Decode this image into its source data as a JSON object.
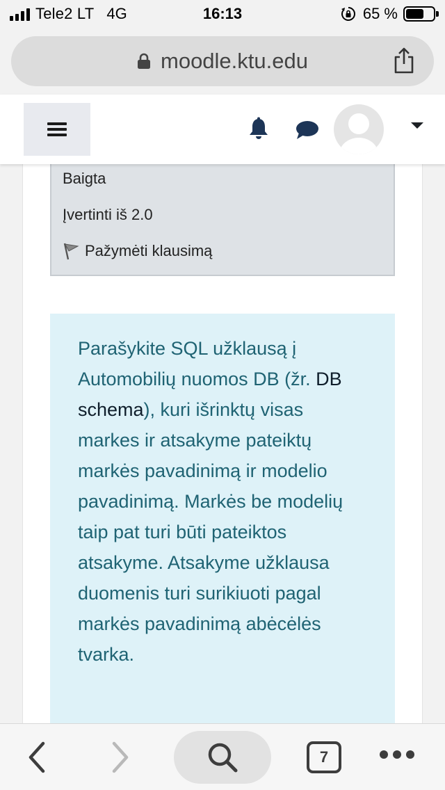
{
  "status_bar": {
    "carrier": "Tele2 LT",
    "network": "4G",
    "time": "16:13",
    "battery_percent": "65 %",
    "battery_level": 0.65
  },
  "browser": {
    "url": "moodle.ktu.edu"
  },
  "moodle_header": {
    "menu_icon": "hamburger-icon",
    "notifications_icon": "bell-icon",
    "messages_icon": "chat-bubble-icon",
    "avatar_icon": "user-avatar-icon",
    "dropdown_icon": "caret-down-icon"
  },
  "question_info": {
    "status": "Baigta",
    "grade": "Įvertinti iš 2.0",
    "flag_label": "Pažymėti klausimą"
  },
  "question": {
    "part1": "Parašykite SQL užklausą į Automobilių nuomos DB (žr. ",
    "link_text": "DB schema",
    "part2": "), kuri išrinktų visas markes ir atsakyme pateiktų markės pavadinimą ir modelio pavadinimą. Markės be modelių taip pat turi būti pateiktos",
    "part3": "atsakyme. Atsakyme užklausa duomenis turi surikiuoti pagal markės pavadinimą abėcėlės tvarka."
  },
  "toolbar": {
    "tab_count": "7"
  },
  "colors": {
    "question_bg": "#def2f8",
    "question_text": "#1f6373",
    "info_bg": "#dee2e6"
  }
}
